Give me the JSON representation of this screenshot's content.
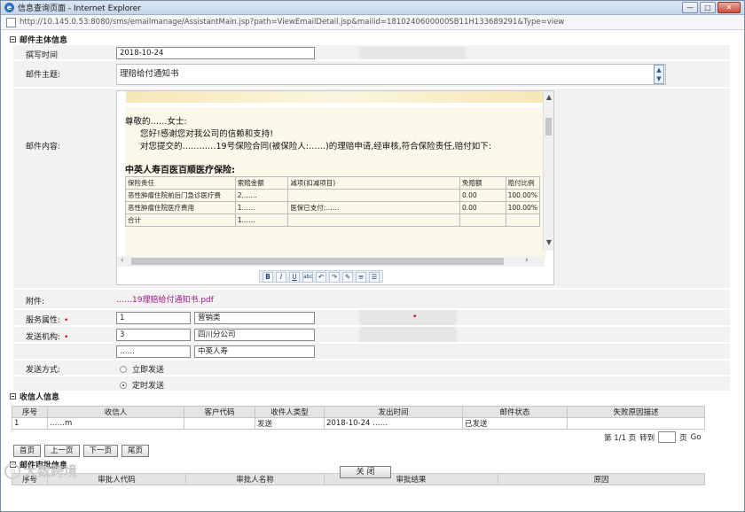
{
  "window": {
    "title": "信息查询页面 - Internet Explorer",
    "url": "http://10.145.0.53:8080/sms/emailmanage/AssistantMain.jsp?path=ViewEmailDetail.jsp&mailid=1810240600000SB11H133689291&Type=view",
    "min": "—",
    "max": "□",
    "close": "✕"
  },
  "mail": {
    "section_title": "邮件主体信息",
    "write_time_label": "撰写时间",
    "write_time_value": "2018-10-24",
    "subject_label": "邮件主题:",
    "subject_value": "理赔给付通知书",
    "content_label": "邮件内容:",
    "letter": {
      "greeting": "尊敬的……女士:",
      "line1": "您好!感谢您对我公司的信赖和支持!",
      "line2": "对您提交的…………19号保险合同(被保险人:……)的理赔申请,经审核,符合保险责任,赔付如下:",
      "company": "中英人寿百医百顺医疗保险:",
      "table_header": [
        "保险责任",
        "索赔金额",
        "减项(扣减项目)",
        "免赔额",
        "赔付比例"
      ],
      "table_rows": [
        [
          "恶性肿瘤住院前后门急诊医疗费",
          "2,……",
          "",
          "0.00",
          "100.00%"
        ],
        [
          "恶性肿瘤住院医疗费用",
          "1……",
          "医保已支付:……",
          "0.00",
          "100.00%"
        ],
        [
          "合计",
          "1……",
          "",
          "",
          ""
        ]
      ]
    },
    "toolbar": [
      "B",
      "I",
      "U",
      "abc",
      "↶",
      "↷",
      "✎",
      "≡",
      "☰"
    ],
    "attachment_label": "附件:",
    "attachment_value": "……19理赔给付通知书.pdf",
    "service_label": "服务属性:",
    "service_code": "1",
    "service_name": "营销类",
    "send_org_label": "发送机构:",
    "send_org_code": "3",
    "send_org_name": "四川分公司",
    "third_code": "……",
    "third_name": "中英人寿",
    "send_mode_label": "发送方式:",
    "send_now": "立即发送",
    "send_timed": "定时发送"
  },
  "recipients": {
    "section_title": "收信人信息",
    "columns": [
      "序号",
      "收信人",
      "客户代码",
      "收件人类型",
      "发出时间",
      "邮件状态",
      "失败原因描述"
    ],
    "rows": [
      [
        "1",
        "……m",
        "",
        "发送",
        "2018-10-24 ……",
        "已发送",
        ""
      ]
    ],
    "page_info": "第 1/1 页",
    "goto_label": "转到",
    "page_suffix": "页",
    "go": "Go",
    "buttons": {
      "first": "首页",
      "prev": "上一页",
      "next": "下一页",
      "last": "尾页"
    }
  },
  "review": {
    "section_title": "邮件审批信息",
    "columns": [
      "序号",
      "审批人代码",
      "审批人名称",
      "审批结果",
      "原因"
    ]
  },
  "close_label": "关 闭",
  "watermark": "大数跨境",
  "colors": {
    "required": "#d40000",
    "attachment": "#a01b86"
  }
}
